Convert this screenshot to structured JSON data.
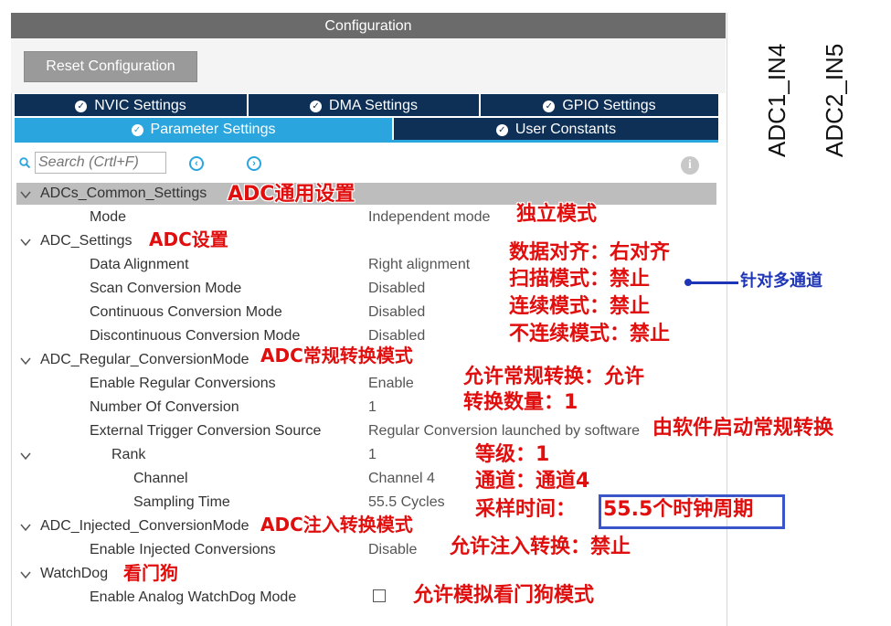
{
  "window": {
    "title": "Configuration"
  },
  "toolbar": {
    "reset_label": "Reset Configuration"
  },
  "tabs": [
    {
      "label": "NVIC Settings",
      "active": false
    },
    {
      "label": "DMA Settings",
      "active": false
    },
    {
      "label": "GPIO Settings",
      "active": false
    },
    {
      "label": "Parameter Settings",
      "active": true
    },
    {
      "label": "User Constants",
      "active": false
    }
  ],
  "search": {
    "placeholder": "Search (Crtl+F)"
  },
  "tree": {
    "common": {
      "label": "ADCs_Common_Settings",
      "mode_label": "Mode",
      "mode_value": "Independent mode"
    },
    "adc_settings": {
      "label": "ADC_Settings",
      "rows": [
        {
          "label": "Data Alignment",
          "value": "Right alignment"
        },
        {
          "label": "Scan Conversion Mode",
          "value": "Disabled"
        },
        {
          "label": "Continuous Conversion Mode",
          "value": "Disabled"
        },
        {
          "label": "Discontinuous Conversion Mode",
          "value": "Disabled"
        }
      ]
    },
    "regular": {
      "label": "ADC_Regular_ConversionMode",
      "rows": [
        {
          "label": "Enable Regular Conversions",
          "value": "Enable"
        },
        {
          "label": "Number Of Conversion",
          "value": "1"
        },
        {
          "label": "External Trigger Conversion Source",
          "value": "Regular Conversion launched by software"
        }
      ],
      "rank": {
        "label": "Rank",
        "value": "1"
      },
      "rank_rows": [
        {
          "label": "Channel",
          "value": "Channel 4"
        },
        {
          "label": "Sampling Time",
          "value": "55.5 Cycles"
        }
      ]
    },
    "injected": {
      "label": "ADC_Injected_ConversionMode",
      "rows": [
        {
          "label": "Enable Injected Conversions",
          "value": "Disable"
        }
      ]
    },
    "watchdog": {
      "label": "WatchDog",
      "rows": [
        {
          "label": "Enable Analog WatchDog Mode",
          "checked": false
        }
      ]
    }
  },
  "annotations": {
    "common": "ADC通用设置",
    "mode": "独立模式",
    "adc_settings": "ADC设置",
    "align": "数据对齐：右对齐",
    "scan": "扫描模式：禁止",
    "continuous": "连续模式：禁止",
    "discontinuous": "不连续模式：禁止",
    "scan_note": "针对多通道",
    "regular": "ADC常规转换模式",
    "enable_regular": "允许常规转换：允许",
    "num_conv": "转换数量：1",
    "trigger": "由软件启动常规转换",
    "rank": "等级：1",
    "channel": "通道：通道4",
    "sampling": "采样时间：",
    "sampling_value": "55.5个时钟周期",
    "injected": "ADC注入转换模式",
    "enable_injected": "允许注入转换：禁止",
    "watchdog": "看门狗",
    "enable_watchdog": "允许模拟看门狗模式"
  },
  "side_labels": [
    "ADC1_IN4",
    "ADC2_IN5"
  ],
  "colors": {
    "tab_dark": "#0e2f56",
    "tab_active": "#2aa5de",
    "annotation_red": "#e10e0e",
    "annotation_blue": "#1f35b8"
  }
}
